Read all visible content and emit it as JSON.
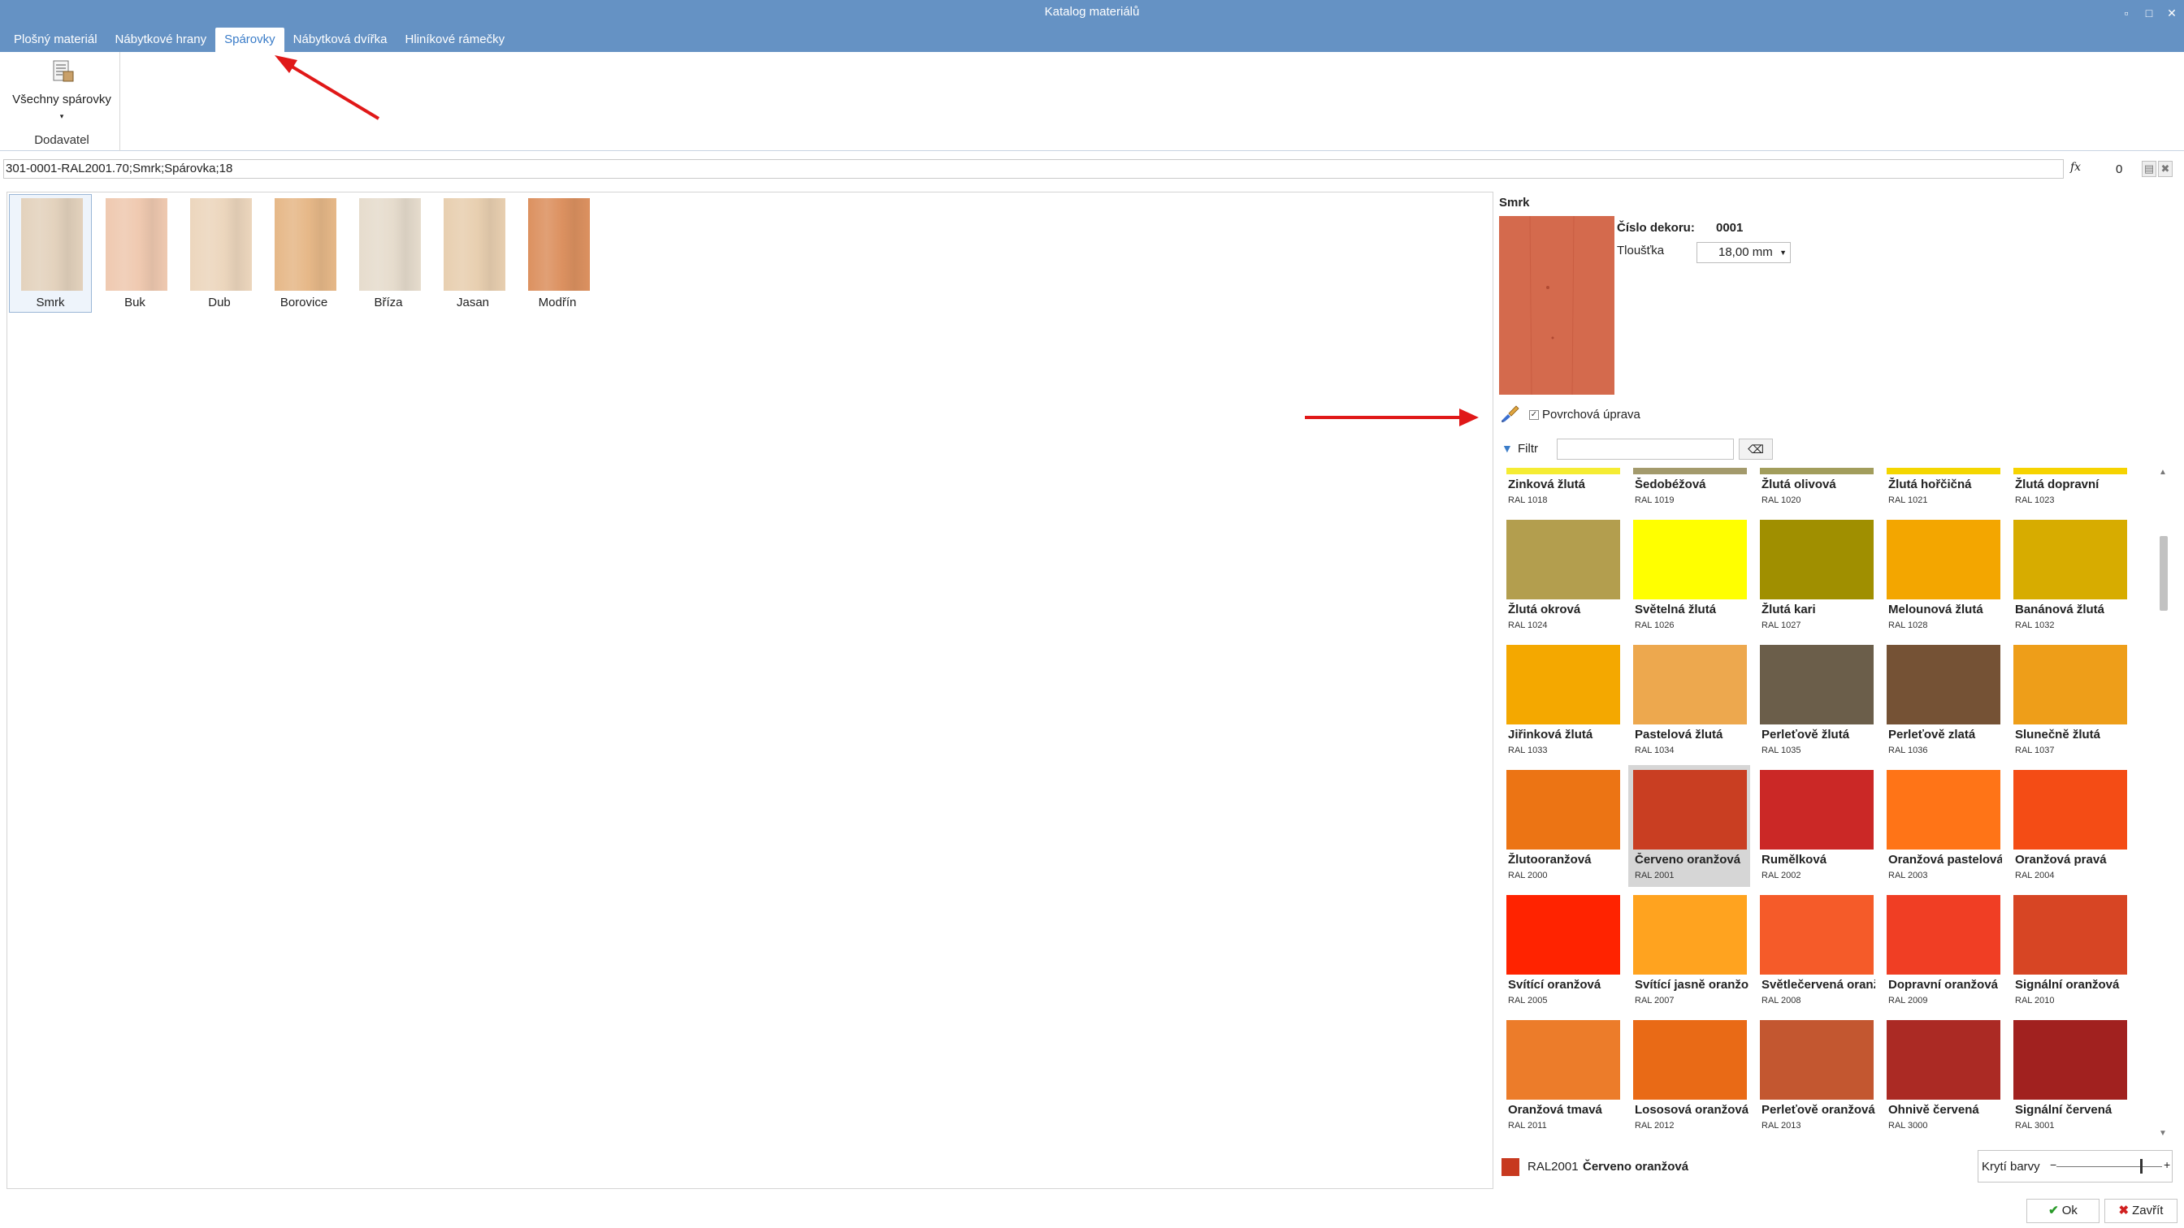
{
  "window": {
    "title": "Katalog materiálů",
    "controls": [
      "▫",
      "□",
      "✕"
    ]
  },
  "tabs": [
    {
      "label": "Plošný materiál"
    },
    {
      "label": "Nábytkové hrany"
    },
    {
      "label": "Spárovky",
      "active": true
    },
    {
      "label": "Nábytková dvířka"
    },
    {
      "label": "Hliníkové rámečky"
    }
  ],
  "ribbon": {
    "button_label": "Všechny spárovky",
    "caret": "▾",
    "group_label": "Dodavatel"
  },
  "pathbar": {
    "value": "301-0001-RAL2001.70;Smrk;Spárovka;18",
    "fx": "fx",
    "counter": "0"
  },
  "materials": [
    {
      "label": "Smrk",
      "color": "#e3d2bd",
      "selected": true
    },
    {
      "label": "Buk",
      "color": "#efc9b0"
    },
    {
      "label": "Dub",
      "color": "#ecd6bd"
    },
    {
      "label": "Borovice",
      "color": "#e6b888"
    },
    {
      "label": "Bříza",
      "color": "#e6dccd"
    },
    {
      "label": "Jasan",
      "color": "#e8cfb0"
    },
    {
      "label": "Modřín",
      "color": "#dc9160"
    }
  ],
  "detail": {
    "title": "Smrk",
    "cislo_label": "Číslo dekoru:",
    "cislo_value": "0001",
    "tloustka_label": "Tloušťka",
    "tloustka_value": "18,00 mm",
    "povrchova_label": "Povrchová úprava",
    "povrchova_checked": true,
    "filtr_label": "Filtr",
    "filtr_value": ""
  },
  "swatches": [
    {
      "name": "Zinková žlutá",
      "code": "RAL 1018",
      "color": "#f5ec33"
    },
    {
      "name": "Šedobéžová",
      "code": "RAL 1019",
      "color": "#a39a6c"
    },
    {
      "name": "Žlutá olivová",
      "code": "RAL 1020",
      "color": "#a29d5c"
    },
    {
      "name": "Žlutá hořčičná",
      "code": "RAL 1021",
      "color": "#f4d600"
    },
    {
      "name": "Žlutá dopravní",
      "code": "RAL 1023",
      "color": "#f6d300"
    },
    {
      "name": "Žlutá okrová",
      "code": "RAL 1024",
      "color": "#b39e4e"
    },
    {
      "name": "Světelná žlutá",
      "code": "RAL 1026",
      "color": "#ffff00"
    },
    {
      "name": "Žlutá kari",
      "code": "RAL 1027",
      "color": "#a08f00"
    },
    {
      "name": "Melounová žlutá",
      "code": "RAL 1028",
      "color": "#f3a600"
    },
    {
      "name": "Banánová žlutá",
      "code": "RAL 1032",
      "color": "#d7ac00"
    },
    {
      "name": "Jiřinková žlutá",
      "code": "RAL 1033",
      "color": "#f4a800"
    },
    {
      "name": "Pastelová žlutá",
      "code": "RAL 1034",
      "color": "#eda84e"
    },
    {
      "name": "Perleťově žlutá",
      "code": "RAL 1035",
      "color": "#6b5e4a"
    },
    {
      "name": "Perleťově zlatá",
      "code": "RAL 1036",
      "color": "#755235"
    },
    {
      "name": "Slunečně žlutá",
      "code": "RAL 1037",
      "color": "#ee9e19"
    },
    {
      "name": "Žlutooranžová",
      "code": "RAL 2000",
      "color": "#ec7414"
    },
    {
      "name": "Červeno oranžová",
      "code": "RAL 2001",
      "color": "#c93e22",
      "selected": true
    },
    {
      "name": "Rumělková",
      "code": "RAL 2002",
      "color": "#cb2826"
    },
    {
      "name": "Oranžová pastelová",
      "code": "RAL 2003",
      "color": "#ff7417"
    },
    {
      "name": "Oranžová pravá",
      "code": "RAL 2004",
      "color": "#f44c15"
    },
    {
      "name": "Svítící oranžová",
      "code": "RAL 2005",
      "color": "#ff2300"
    },
    {
      "name": "Svítící jasně oranžová",
      "code": "RAL 2007",
      "color": "#ffa31f"
    },
    {
      "name": "Světlečervená oranžová",
      "code": "RAL 2008",
      "color": "#f55b29"
    },
    {
      "name": "Dopravní oranžová",
      "code": "RAL 2009",
      "color": "#f03e24"
    },
    {
      "name": "Signální oranžová",
      "code": "RAL 2010",
      "color": "#d74524"
    },
    {
      "name": "Oranžová tmavá",
      "code": "RAL 2011",
      "color": "#ec7c2a"
    },
    {
      "name": "Lososová oranžová",
      "code": "RAL 2012",
      "color": "#e96a16"
    },
    {
      "name": "Perleťově oranžová",
      "code": "RAL 2013",
      "color": "#c35730"
    },
    {
      "name": "Ohnivě červená",
      "code": "RAL 3000",
      "color": "#ab2a24"
    },
    {
      "name": "Signální červená",
      "code": "RAL 3001",
      "color": "#a1211f"
    }
  ],
  "selected": {
    "code": "RAL2001",
    "name": "Červeno oranžová",
    "color": "#c7391f"
  },
  "kryti": {
    "label": "Krytí barvy",
    "minus": "−",
    "plus": "+",
    "level": 0.8
  },
  "buttons": {
    "ok": "Ok",
    "close": "Zavřít"
  },
  "colors": {
    "titlebar": "#6592c4",
    "annotation_arrow": "#e01818"
  }
}
